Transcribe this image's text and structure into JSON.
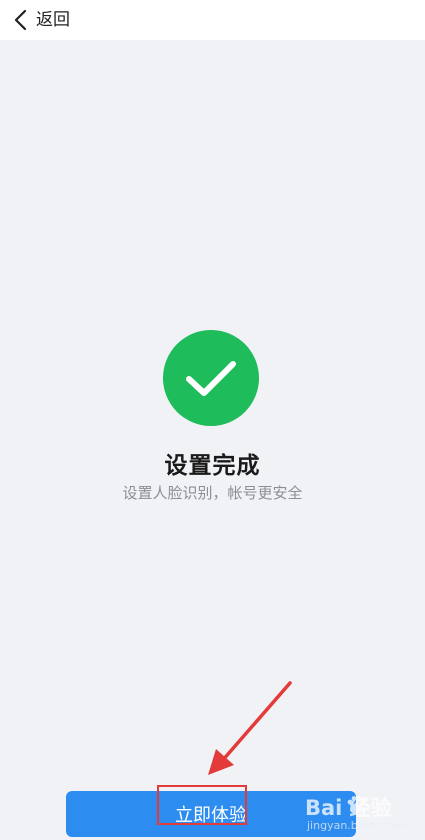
{
  "header": {
    "back_label": "返回"
  },
  "status": {
    "icon": "checkmark-icon",
    "circle_color": "#1ebc5a",
    "title": "设置完成",
    "subtitle": "设置人脸识别，帐号更安全"
  },
  "action": {
    "button_label": "立即体验",
    "button_color": "#2d8cf0"
  },
  "annotation": {
    "highlight_color": "#e33a3a"
  },
  "watermark": {
    "brand": "Bai  经验",
    "url": "jingyan.baidu.com"
  }
}
